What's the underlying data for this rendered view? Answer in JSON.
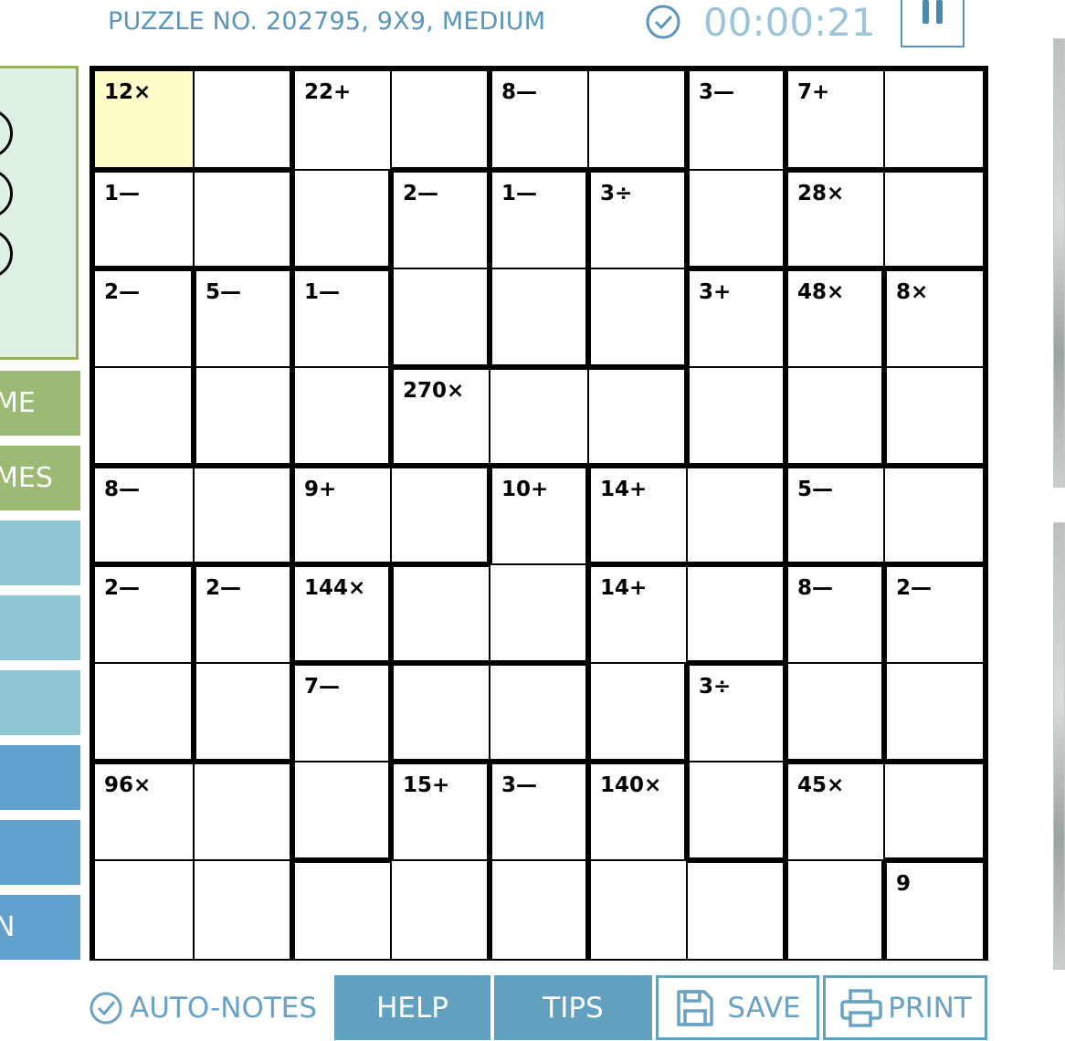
{
  "header": {
    "puzzle_title": "PUZZLE NO. 202795, 9X9, MEDIUM",
    "timer": "00:00:21"
  },
  "sidebar": {
    "buttons": [
      {
        "label": "ME",
        "color": "#9cba74"
      },
      {
        "label": "MES",
        "color": "#9cba74"
      },
      {
        "label": "",
        "color": "#8fc6d3"
      },
      {
        "label": "",
        "color": "#8fc6d3"
      },
      {
        "label": "",
        "color": "#8fc6d3"
      },
      {
        "label": "",
        "color": "#62a0cd"
      },
      {
        "label": "",
        "color": "#62a0cd"
      },
      {
        "label": "N",
        "color": "#62a0cd"
      }
    ]
  },
  "puzzle": {
    "size": 9,
    "selected_cell": [
      0,
      0
    ],
    "clues": [
      {
        "row": 0,
        "col": 0,
        "text": "12×"
      },
      {
        "row": 0,
        "col": 2,
        "text": "22+"
      },
      {
        "row": 0,
        "col": 4,
        "text": "8—"
      },
      {
        "row": 0,
        "col": 6,
        "text": "3—"
      },
      {
        "row": 0,
        "col": 7,
        "text": "7+"
      },
      {
        "row": 1,
        "col": 0,
        "text": "1—"
      },
      {
        "row": 1,
        "col": 3,
        "text": "2—"
      },
      {
        "row": 1,
        "col": 4,
        "text": "1—"
      },
      {
        "row": 1,
        "col": 5,
        "text": "3÷"
      },
      {
        "row": 1,
        "col": 7,
        "text": "28×"
      },
      {
        "row": 2,
        "col": 0,
        "text": "2—"
      },
      {
        "row": 2,
        "col": 1,
        "text": "5—"
      },
      {
        "row": 2,
        "col": 2,
        "text": "1—"
      },
      {
        "row": 2,
        "col": 6,
        "text": "3+"
      },
      {
        "row": 2,
        "col": 7,
        "text": "48×"
      },
      {
        "row": 2,
        "col": 8,
        "text": "8×"
      },
      {
        "row": 3,
        "col": 3,
        "text": "270×"
      },
      {
        "row": 4,
        "col": 0,
        "text": "8—"
      },
      {
        "row": 4,
        "col": 2,
        "text": "9+"
      },
      {
        "row": 4,
        "col": 4,
        "text": "10+"
      },
      {
        "row": 4,
        "col": 5,
        "text": "14+"
      },
      {
        "row": 4,
        "col": 7,
        "text": "5—"
      },
      {
        "row": 5,
        "col": 0,
        "text": "2—"
      },
      {
        "row": 5,
        "col": 1,
        "text": "2—"
      },
      {
        "row": 5,
        "col": 2,
        "text": "144×"
      },
      {
        "row": 5,
        "col": 5,
        "text": "14+"
      },
      {
        "row": 5,
        "col": 7,
        "text": "8—"
      },
      {
        "row": 5,
        "col": 8,
        "text": "2—"
      },
      {
        "row": 6,
        "col": 2,
        "text": "7—"
      },
      {
        "row": 6,
        "col": 6,
        "text": "3÷"
      },
      {
        "row": 7,
        "col": 0,
        "text": "96×"
      },
      {
        "row": 7,
        "col": 3,
        "text": "15+"
      },
      {
        "row": 7,
        "col": 4,
        "text": "3—"
      },
      {
        "row": 7,
        "col": 5,
        "text": "140×"
      },
      {
        "row": 7,
        "col": 7,
        "text": "45×"
      },
      {
        "row": 8,
        "col": 8,
        "text": "9"
      }
    ],
    "cages": [
      [
        [
          0,
          0
        ],
        [
          0,
          1
        ]
      ],
      [
        [
          0,
          2
        ],
        [
          0,
          3
        ],
        [
          1,
          2
        ]
      ],
      [
        [
          0,
          4
        ],
        [
          0,
          5
        ]
      ],
      [
        [
          0,
          6
        ],
        [
          1,
          6
        ]
      ],
      [
        [
          0,
          7
        ],
        [
          0,
          8
        ]
      ],
      [
        [
          1,
          0
        ],
        [
          1,
          1
        ]
      ],
      [
        [
          1,
          3
        ],
        [
          2,
          3
        ]
      ],
      [
        [
          1,
          4
        ],
        [
          2,
          4
        ]
      ],
      [
        [
          1,
          5
        ],
        [
          2,
          5
        ]
      ],
      [
        [
          1,
          7
        ],
        [
          1,
          8
        ]
      ],
      [
        [
          2,
          0
        ],
        [
          3,
          0
        ]
      ],
      [
        [
          2,
          1
        ],
        [
          3,
          1
        ]
      ],
      [
        [
          2,
          2
        ],
        [
          3,
          2
        ]
      ],
      [
        [
          2,
          6
        ],
        [
          3,
          6
        ]
      ],
      [
        [
          2,
          7
        ],
        [
          3,
          7
        ]
      ],
      [
        [
          2,
          8
        ],
        [
          3,
          8
        ]
      ],
      [
        [
          3,
          3
        ],
        [
          3,
          4
        ],
        [
          3,
          5
        ]
      ],
      [
        [
          4,
          0
        ],
        [
          4,
          1
        ]
      ],
      [
        [
          4,
          2
        ],
        [
          4,
          3
        ]
      ],
      [
        [
          4,
          4
        ],
        [
          5,
          4
        ],
        [
          5,
          3
        ]
      ],
      [
        [
          4,
          5
        ],
        [
          4,
          6
        ]
      ],
      [
        [
          4,
          7
        ],
        [
          4,
          8
        ]
      ],
      [
        [
          5,
          0
        ],
        [
          6,
          0
        ]
      ],
      [
        [
          5,
          1
        ],
        [
          6,
          1
        ]
      ],
      [
        [
          5,
          2
        ]
      ],
      [
        [
          5,
          5
        ],
        [
          5,
          6
        ],
        [
          6,
          5
        ]
      ],
      [
        [
          5,
          7
        ],
        [
          6,
          7
        ]
      ],
      [
        [
          5,
          8
        ],
        [
          6,
          8
        ]
      ],
      [
        [
          6,
          2
        ],
        [
          7,
          2
        ]
      ],
      [
        [
          6,
          3
        ],
        [
          6,
          4
        ]
      ],
      [
        [
          6,
          6
        ],
        [
          7,
          6
        ]
      ],
      [
        [
          7,
          0
        ],
        [
          7,
          1
        ],
        [
          8,
          0
        ],
        [
          8,
          1
        ]
      ],
      [
        [
          7,
          3
        ],
        [
          8,
          2
        ],
        [
          8,
          3
        ]
      ],
      [
        [
          7,
          4
        ],
        [
          8,
          4
        ]
      ],
      [
        [
          7,
          5
        ],
        [
          8,
          5
        ],
        [
          8,
          6
        ]
      ],
      [
        [
          7,
          7
        ],
        [
          7,
          8
        ],
        [
          8,
          7
        ]
      ],
      [
        [
          8,
          8
        ]
      ]
    ]
  },
  "toolbar": {
    "autonotes_label": "AUTO-NOTES",
    "help_label": "HELP",
    "tips_label": "TIPS",
    "save_label": "SAVE",
    "print_label": "PRINT"
  },
  "colors": {
    "accent": "#62a0c0",
    "selected_cell": "#fffdc9"
  }
}
